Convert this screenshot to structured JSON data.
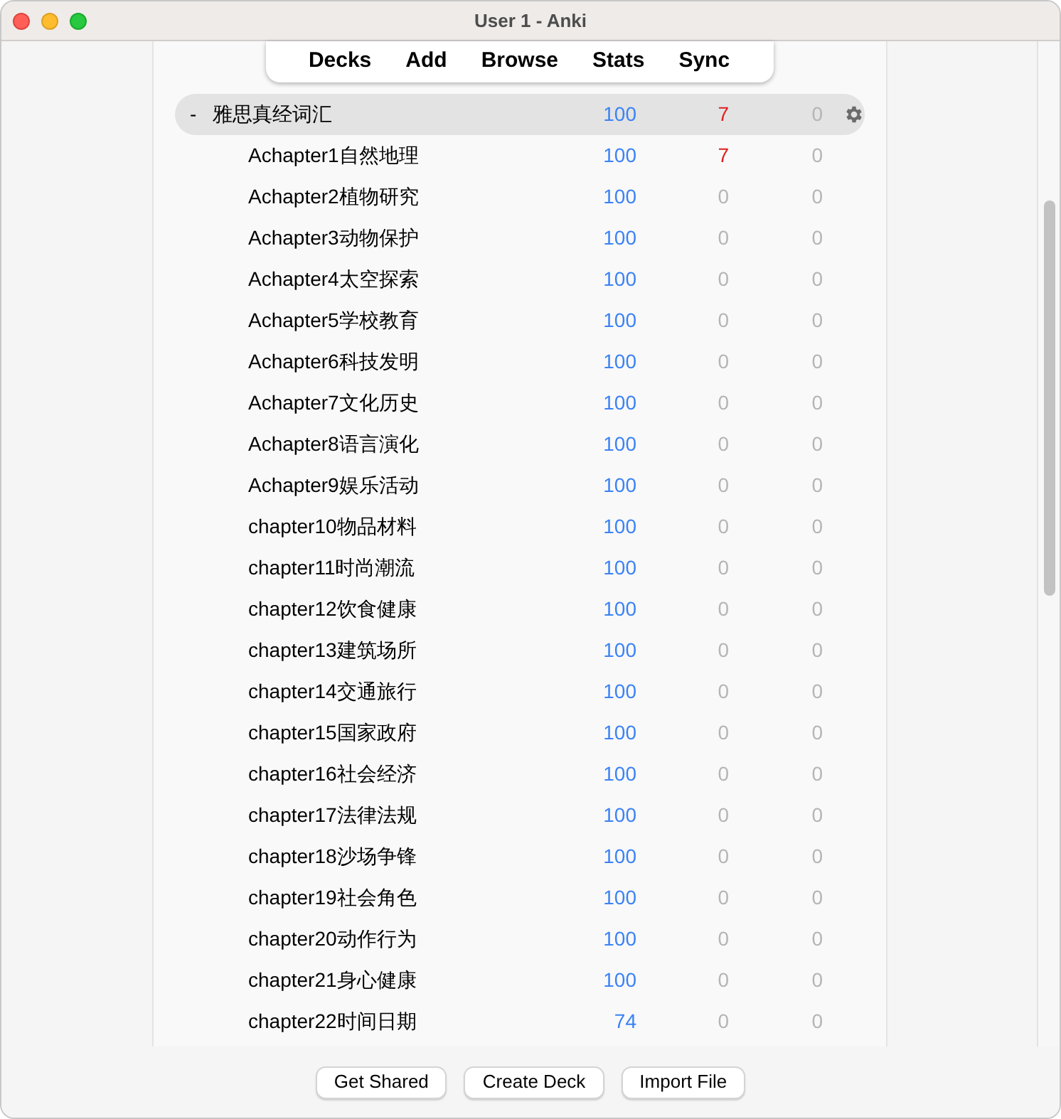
{
  "window": {
    "title": "User 1 - Anki"
  },
  "toolbar": [
    "Decks",
    "Add",
    "Browse",
    "Stats",
    "Sync"
  ],
  "decks": [
    {
      "name": "雅思真经词汇",
      "toggle": "-",
      "selected": true,
      "counts": [
        {
          "text": "100",
          "dim": false
        },
        {
          "text": "7",
          "dim": false
        },
        {
          "text": "0",
          "dim": true
        }
      ],
      "children": [
        {
          "name": "Achapter1自然地理",
          "counts": [
            {
              "text": "100",
              "dim": false
            },
            {
              "text": "7",
              "dim": false
            },
            {
              "text": "0",
              "dim": true
            }
          ]
        },
        {
          "name": "Achapter2植物研究",
          "counts": [
            {
              "text": "100",
              "dim": false
            },
            {
              "text": "0",
              "dim": true
            },
            {
              "text": "0",
              "dim": true
            }
          ]
        },
        {
          "name": "Achapter3动物保护",
          "counts": [
            {
              "text": "100",
              "dim": false
            },
            {
              "text": "0",
              "dim": true
            },
            {
              "text": "0",
              "dim": true
            }
          ]
        },
        {
          "name": "Achapter4太空探索",
          "counts": [
            {
              "text": "100",
              "dim": false
            },
            {
              "text": "0",
              "dim": true
            },
            {
              "text": "0",
              "dim": true
            }
          ]
        },
        {
          "name": "Achapter5学校教育",
          "counts": [
            {
              "text": "100",
              "dim": false
            },
            {
              "text": "0",
              "dim": true
            },
            {
              "text": "0",
              "dim": true
            }
          ]
        },
        {
          "name": "Achapter6科技发明",
          "counts": [
            {
              "text": "100",
              "dim": false
            },
            {
              "text": "0",
              "dim": true
            },
            {
              "text": "0",
              "dim": true
            }
          ]
        },
        {
          "name": "Achapter7文化历史",
          "counts": [
            {
              "text": "100",
              "dim": false
            },
            {
              "text": "0",
              "dim": true
            },
            {
              "text": "0",
              "dim": true
            }
          ]
        },
        {
          "name": "Achapter8语言演化",
          "counts": [
            {
              "text": "100",
              "dim": false
            },
            {
              "text": "0",
              "dim": true
            },
            {
              "text": "0",
              "dim": true
            }
          ]
        },
        {
          "name": "Achapter9娱乐活动",
          "counts": [
            {
              "text": "100",
              "dim": false
            },
            {
              "text": "0",
              "dim": true
            },
            {
              "text": "0",
              "dim": true
            }
          ]
        },
        {
          "name": "chapter10物品材料",
          "counts": [
            {
              "text": "100",
              "dim": false
            },
            {
              "text": "0",
              "dim": true
            },
            {
              "text": "0",
              "dim": true
            }
          ]
        },
        {
          "name": "chapter11时尚潮流",
          "counts": [
            {
              "text": "100",
              "dim": false
            },
            {
              "text": "0",
              "dim": true
            },
            {
              "text": "0",
              "dim": true
            }
          ]
        },
        {
          "name": "chapter12饮食健康",
          "counts": [
            {
              "text": "100",
              "dim": false
            },
            {
              "text": "0",
              "dim": true
            },
            {
              "text": "0",
              "dim": true
            }
          ]
        },
        {
          "name": "chapter13建筑场所",
          "counts": [
            {
              "text": "100",
              "dim": false
            },
            {
              "text": "0",
              "dim": true
            },
            {
              "text": "0",
              "dim": true
            }
          ]
        },
        {
          "name": "chapter14交通旅行",
          "counts": [
            {
              "text": "100",
              "dim": false
            },
            {
              "text": "0",
              "dim": true
            },
            {
              "text": "0",
              "dim": true
            }
          ]
        },
        {
          "name": "chapter15国家政府",
          "counts": [
            {
              "text": "100",
              "dim": false
            },
            {
              "text": "0",
              "dim": true
            },
            {
              "text": "0",
              "dim": true
            }
          ]
        },
        {
          "name": "chapter16社会经济",
          "counts": [
            {
              "text": "100",
              "dim": false
            },
            {
              "text": "0",
              "dim": true
            },
            {
              "text": "0",
              "dim": true
            }
          ]
        },
        {
          "name": "chapter17法律法规",
          "counts": [
            {
              "text": "100",
              "dim": false
            },
            {
              "text": "0",
              "dim": true
            },
            {
              "text": "0",
              "dim": true
            }
          ]
        },
        {
          "name": "chapter18沙场争锋",
          "counts": [
            {
              "text": "100",
              "dim": false
            },
            {
              "text": "0",
              "dim": true
            },
            {
              "text": "0",
              "dim": true
            }
          ]
        },
        {
          "name": "chapter19社会角色",
          "counts": [
            {
              "text": "100",
              "dim": false
            },
            {
              "text": "0",
              "dim": true
            },
            {
              "text": "0",
              "dim": true
            }
          ]
        },
        {
          "name": "chapter20动作行为",
          "counts": [
            {
              "text": "100",
              "dim": false
            },
            {
              "text": "0",
              "dim": true
            },
            {
              "text": "0",
              "dim": true
            }
          ]
        },
        {
          "name": "chapter21身心健康",
          "counts": [
            {
              "text": "100",
              "dim": false
            },
            {
              "text": "0",
              "dim": true
            },
            {
              "text": "0",
              "dim": true
            }
          ]
        },
        {
          "name": "chapter22时间日期",
          "counts": [
            {
              "text": "74",
              "dim": false
            },
            {
              "text": "0",
              "dim": true
            },
            {
              "text": "0",
              "dim": true
            }
          ]
        }
      ]
    }
  ],
  "buttons": [
    "Get Shared",
    "Create Deck",
    "Import File"
  ]
}
